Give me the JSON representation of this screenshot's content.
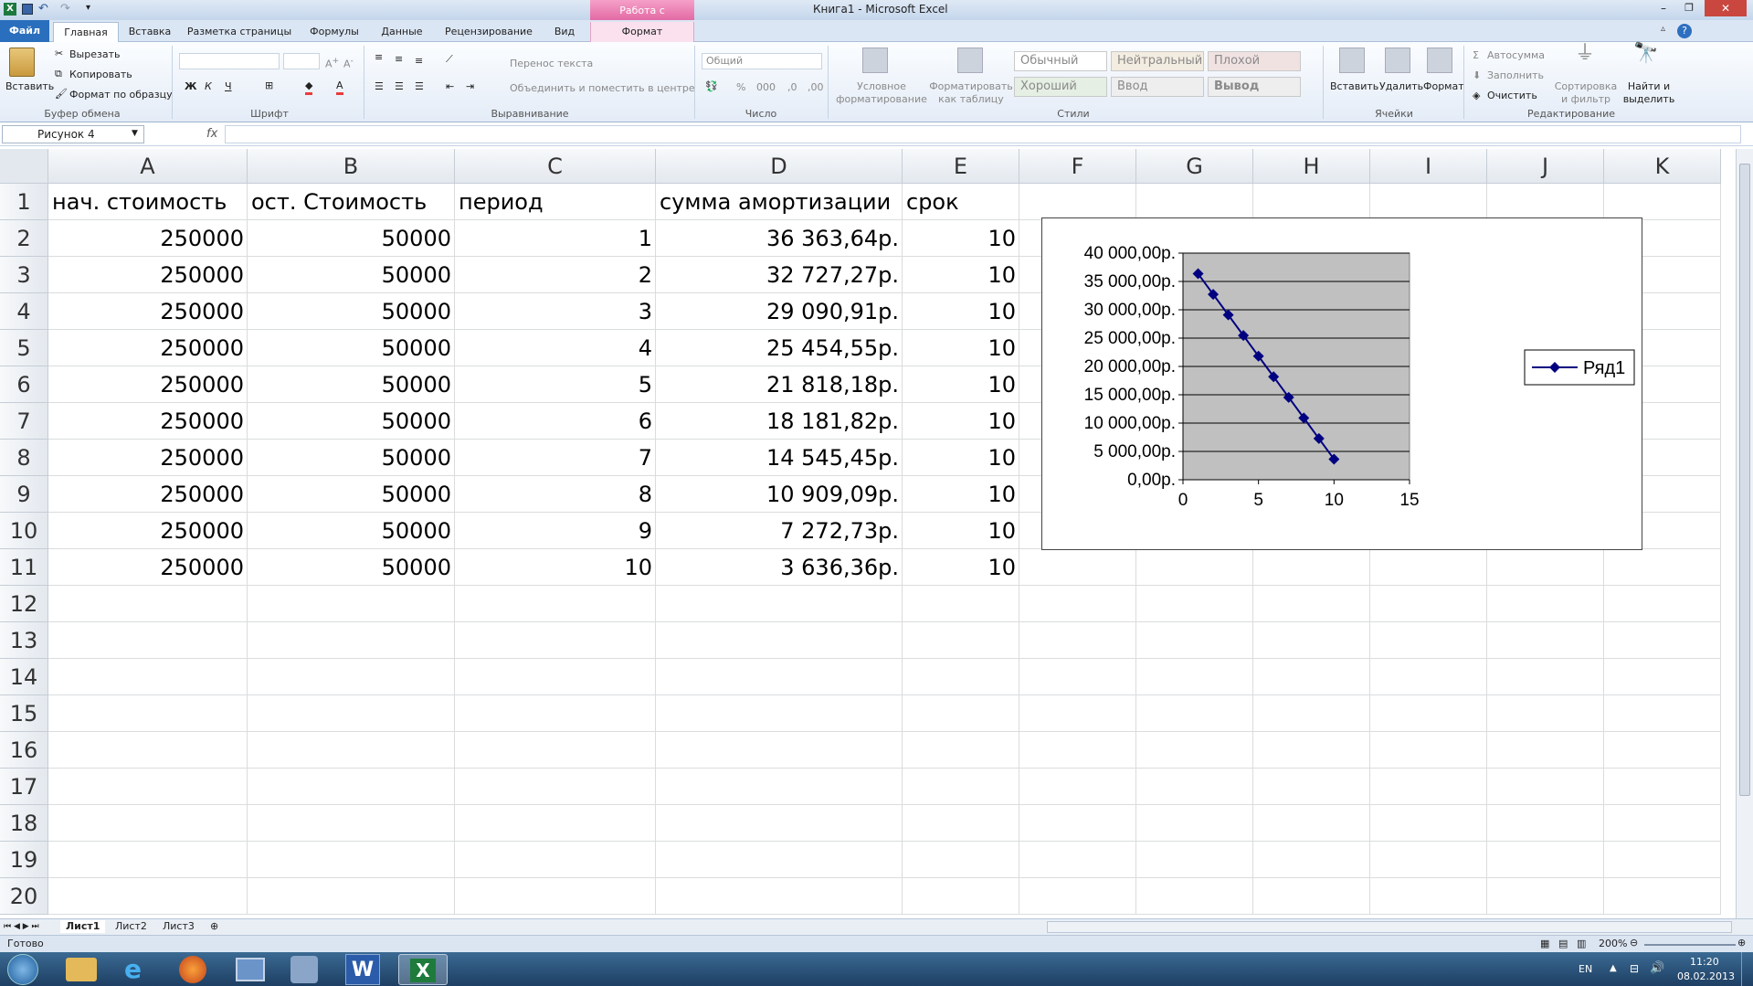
{
  "window": {
    "title": "Книга1  -  Microsoft Excel",
    "context_tab_group": "Работа с рисунками",
    "context_tab": "Формат"
  },
  "ribbon_tabs": [
    "Файл",
    "Главная",
    "Вставка",
    "Разметка страницы",
    "Формулы",
    "Данные",
    "Рецензирование",
    "Вид"
  ],
  "ribbon": {
    "clipboard": {
      "paste": "Вставить",
      "cut": "Вырезать",
      "copy": "Копировать",
      "format_painter": "Формат по образцу",
      "label": "Буфер обмена"
    },
    "font": {
      "bold": "Ж",
      "italic": "К",
      "underline": "Ч",
      "label": "Шрифт"
    },
    "alignment": {
      "wrap": "Перенос текста",
      "merge": "Объединить и поместить в центре",
      "label": "Выравнивание"
    },
    "number": {
      "format": "Общий",
      "label": "Число"
    },
    "styles": {
      "conditional": "Условное форматирование",
      "as_table": "Форматировать как таблицу",
      "cells": [
        "Обычный",
        "Нейтральный",
        "Плохой",
        "Хороший",
        "Ввод",
        "Вывод"
      ],
      "label": "Стили"
    },
    "cells": {
      "insert": "Вставить",
      "delete": "Удалить",
      "format": "Формат",
      "label": "Ячейки"
    },
    "editing": {
      "autosum": "Автосумма",
      "fill": "Заполнить",
      "clear": "Очистить",
      "sort": "Сортировка и фильтр",
      "find": "Найти и выделить",
      "label": "Редактирование"
    }
  },
  "formula_bar": {
    "name_box": "Рисунок 4",
    "fx": "fx",
    "value": ""
  },
  "columns": [
    "A",
    "B",
    "C",
    "D",
    "E",
    "F",
    "G",
    "H",
    "I",
    "J",
    "K"
  ],
  "rows": [
    "1",
    "2",
    "3",
    "4",
    "5",
    "6",
    "7",
    "8",
    "9",
    "10",
    "11",
    "12",
    "13",
    "14",
    "15",
    "16",
    "17",
    "18",
    "19",
    "20"
  ],
  "table": {
    "headers": [
      "нач. стоимость",
      "ост. Стоимость",
      "период",
      "сумма амортизации",
      "срок"
    ],
    "data": [
      [
        "250000",
        "50000",
        "1",
        "36 363,64р.",
        "10"
      ],
      [
        "250000",
        "50000",
        "2",
        "32 727,27р.",
        "10"
      ],
      [
        "250000",
        "50000",
        "3",
        "29 090,91р.",
        "10"
      ],
      [
        "250000",
        "50000",
        "4",
        "25 454,55р.",
        "10"
      ],
      [
        "250000",
        "50000",
        "5",
        "21 818,18р.",
        "10"
      ],
      [
        "250000",
        "50000",
        "6",
        "18 181,82р.",
        "10"
      ],
      [
        "250000",
        "50000",
        "7",
        "14 545,45р.",
        "10"
      ],
      [
        "250000",
        "50000",
        "8",
        "10 909,09р.",
        "10"
      ],
      [
        "250000",
        "50000",
        "9",
        "7 272,73р.",
        "10"
      ],
      [
        "250000",
        "50000",
        "10",
        "3 636,36р.",
        "10"
      ]
    ]
  },
  "chart_data": {
    "type": "scatter",
    "x": [
      1,
      2,
      3,
      4,
      5,
      6,
      7,
      8,
      9,
      10
    ],
    "series": [
      {
        "name": "Ряд1",
        "values": [
          36363.64,
          32727.27,
          29090.91,
          25454.55,
          21818.18,
          18181.82,
          14545.45,
          10909.09,
          7272.73,
          3636.36
        ],
        "color": "#000080"
      }
    ],
    "xlim": [
      0,
      15
    ],
    "ylim": [
      0,
      40000
    ],
    "x_ticks": [
      "0",
      "5",
      "10",
      "15"
    ],
    "y_ticks": [
      "0,00р.",
      "5 000,00р.",
      "10 000,00р.",
      "15 000,00р.",
      "20 000,00р.",
      "25 000,00р.",
      "30 000,00р.",
      "35 000,00р.",
      "40 000,00р."
    ],
    "title": "",
    "xlabel": "",
    "ylabel": "",
    "plot_background": "#c0c0c0",
    "grid": true,
    "legend": "right"
  },
  "sheets": [
    "Лист1",
    "Лист2",
    "Лист3"
  ],
  "status": {
    "ready": "Готово",
    "zoom": "200%"
  },
  "taskbar": {
    "lang": "EN",
    "time": "11:20",
    "date": "08.02.2013"
  }
}
